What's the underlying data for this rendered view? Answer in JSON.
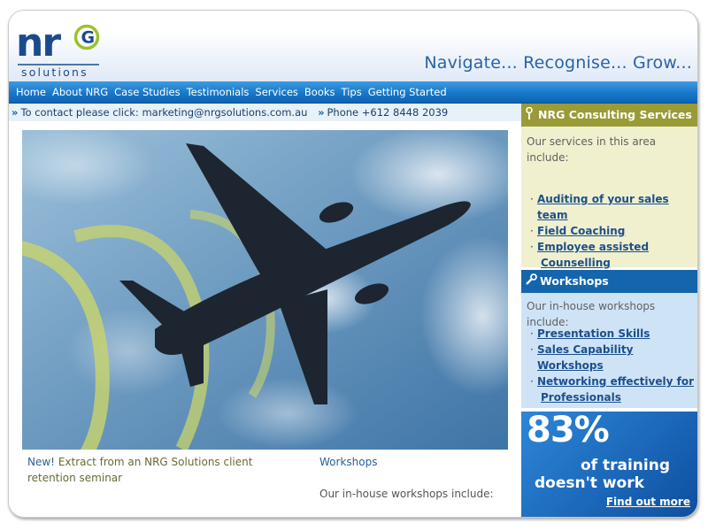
{
  "header": {
    "logo": {
      "letters": "nr",
      "circle_letter": "G",
      "subtitle": "solutions"
    },
    "tagline": "Navigate... Recognise... Grow..."
  },
  "nav": {
    "items": [
      "Home",
      "About NRG",
      "Case Studies",
      "Testimonials",
      "Services",
      "Books",
      "Tips",
      "Getting Started"
    ]
  },
  "contact": {
    "email_text": "To contact please click: marketing@nrgsolutions.com.au",
    "phone_text": "Phone +612 8448 2039"
  },
  "hero": {
    "icon": "airplane-photo"
  },
  "left_col": {
    "new_label": "New!",
    "text": "Extract from an NRG Solutions client retention seminar"
  },
  "mid_col": {
    "heading": "Workshops",
    "text": "Our in-house workshops include:"
  },
  "sidebar": {
    "consulting": {
      "title": "NRG Consulting Services",
      "icon": "wrench-icon",
      "intro": "Our services in this area include:",
      "links": [
        "Auditing of your sales team",
        "Field Coaching",
        "Employee assisted",
        "Counselling"
      ]
    },
    "workshops": {
      "title": "Workshops",
      "icon": "wrench-icon",
      "intro": "Our in-house workshops include:",
      "links": [
        "Presentation Skills",
        "Sales Capability Workshops",
        "Networking effectively for",
        "Professionals"
      ]
    },
    "ad": {
      "percent": "83%",
      "line1": "of training",
      "line2": "doesn't work",
      "link": "Find out more"
    }
  },
  "colors": {
    "nav_blue": "#1877c8",
    "consulting_olive": "#9a9b36",
    "workshops_blue": "#1565ad",
    "link_blue": "#1c4f8c"
  }
}
